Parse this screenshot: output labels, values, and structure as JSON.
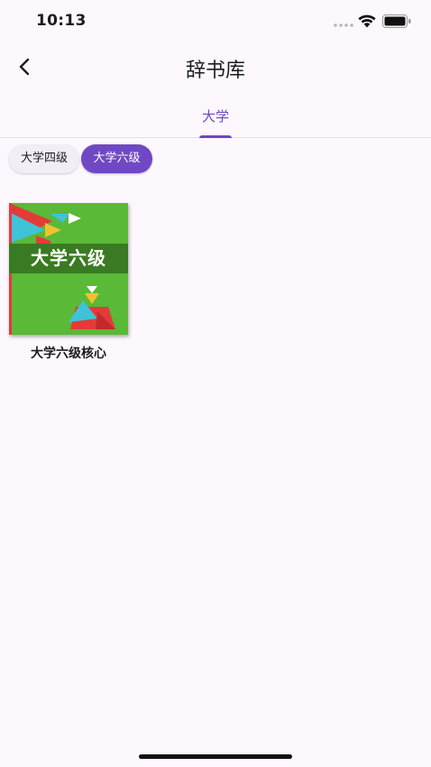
{
  "status_bar": {
    "time": "10:13",
    "icons": [
      "cellular-dots-icon",
      "wifi-icon",
      "battery-icon"
    ]
  },
  "app_bar": {
    "back_icon": "chevron-left-icon",
    "title": "辞书库"
  },
  "tabs": [
    {
      "label": "大学",
      "selected": true
    }
  ],
  "chips": [
    {
      "label": "大学四级",
      "selected": false
    },
    {
      "label": "大学六级",
      "selected": true
    }
  ],
  "books": [
    {
      "cover_title": "大学六级",
      "name": "大学六级核心"
    }
  ],
  "colors": {
    "accent": "#6e45c6",
    "background": "#fcf8fd",
    "cover_green": "#5ab936"
  }
}
